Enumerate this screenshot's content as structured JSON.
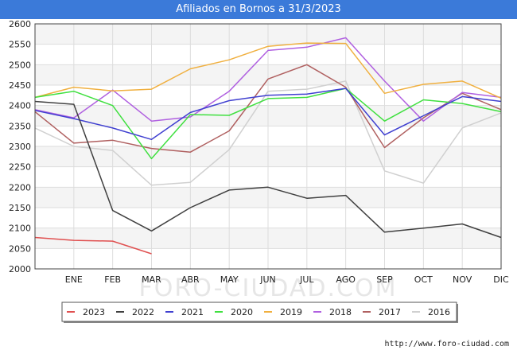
{
  "title": "Afiliados en Bornos a 31/3/2023",
  "source": "http://www.foro-ciudad.com",
  "watermark": "FORO-CIUDAD.COM",
  "chart_data": {
    "type": "line",
    "categories": [
      "ENE",
      "FEB",
      "MAR",
      "ABR",
      "MAY",
      "JUN",
      "JUL",
      "AGO",
      "SEP",
      "OCT",
      "NOV",
      "DIC"
    ],
    "ylim": [
      2000,
      2600
    ],
    "yticks": [
      2000,
      2050,
      2100,
      2150,
      2200,
      2250,
      2300,
      2350,
      2400,
      2450,
      2500,
      2550,
      2600
    ],
    "grid": true,
    "legend_position": "bottom",
    "series": [
      {
        "name": "2016",
        "color": "#d0d0d0",
        "values": [
          2345,
          2300,
          2290,
          2205,
          2212,
          2292,
          2435,
          2440,
          2460,
          2240,
          2210,
          2345,
          2382
        ]
      },
      {
        "name": "2017",
        "color": "#b06060",
        "values": [
          2385,
          2308,
          2315,
          2295,
          2286,
          2338,
          2465,
          2500,
          2445,
          2297,
          2370,
          2430,
          2390
        ]
      },
      {
        "name": "2018",
        "color": "#b060e0",
        "values": [
          2390,
          2370,
          2438,
          2362,
          2372,
          2435,
          2535,
          2543,
          2566,
          2460,
          2362,
          2432,
          2420
        ]
      },
      {
        "name": "2019",
        "color": "#f0b040",
        "values": [
          2420,
          2445,
          2436,
          2440,
          2490,
          2512,
          2545,
          2553,
          2552,
          2430,
          2452,
          2460,
          2418
        ]
      },
      {
        "name": "2020",
        "color": "#40e040",
        "values": [
          2420,
          2435,
          2400,
          2270,
          2378,
          2376,
          2417,
          2420,
          2442,
          2362,
          2414,
          2405,
          2385
        ]
      },
      {
        "name": "2021",
        "color": "#4040d0",
        "values": [
          2388,
          2368,
          2345,
          2317,
          2383,
          2412,
          2425,
          2428,
          2442,
          2328,
          2375,
          2422,
          2410
        ]
      },
      {
        "name": "2022",
        "color": "#404040",
        "values": [
          2410,
          2403,
          2143,
          2093,
          2150,
          2193,
          2200,
          2173,
          2180,
          2090,
          2100,
          2110,
          2077
        ]
      },
      {
        "name": "2023",
        "color": "#e05050",
        "values": [
          2077,
          2070,
          2068,
          2037
        ]
      }
    ],
    "legend_order": [
      "2023",
      "2022",
      "2021",
      "2020",
      "2019",
      "2018",
      "2017",
      "2016"
    ]
  }
}
